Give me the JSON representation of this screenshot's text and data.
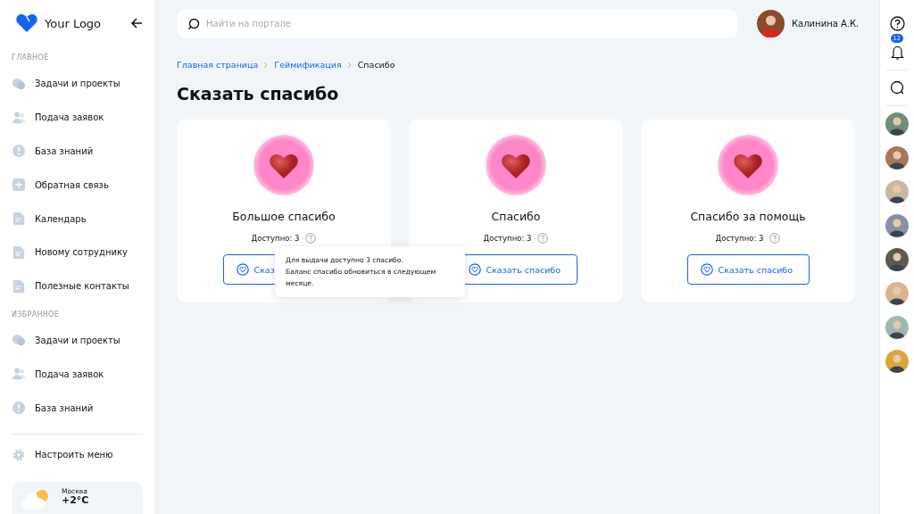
{
  "sidebar": {
    "logo": "Your Logo",
    "sections": [
      {
        "title": "ГЛАВНОЕ",
        "items": [
          {
            "label": "Задачи и проекты",
            "kind": "chat"
          },
          {
            "label": "Подача заявок",
            "kind": "people"
          },
          {
            "label": "База знаний",
            "kind": "info"
          },
          {
            "label": "Обратная связь",
            "kind": "plus"
          },
          {
            "label": "Календарь",
            "kind": "doc"
          },
          {
            "label": "Новому сотруднику",
            "kind": "doc"
          },
          {
            "label": "Полезные контакты",
            "kind": "doc"
          }
        ]
      },
      {
        "title": "ИЗБРАННОЕ",
        "items": [
          {
            "label": "Задачи и проекты",
            "kind": "chat"
          },
          {
            "label": "Подача заявок",
            "kind": "people"
          },
          {
            "label": "База знаний",
            "kind": "info"
          }
        ]
      }
    ],
    "settings": "Настроить меню",
    "weather": {
      "city": "Москва",
      "temperature": "+2°C"
    }
  },
  "search": {
    "placeholder": "Найти на портале"
  },
  "user": {
    "name": "Калинина А.К."
  },
  "breadcrumbs": [
    {
      "label": "Главная страница",
      "kind": "link"
    },
    {
      "label": "Геймификация",
      "kind": "link"
    },
    {
      "label": "Спасибо",
      "kind": "current"
    }
  ],
  "title": "Сказать спасибо",
  "cards": [
    {
      "title": "Большое спасибо",
      "available": "Доступно: 3",
      "button": "Сказ",
      "tooltip": [
        "Для выдачи доступно  3 спасибо.",
        "Баланс спасибо обновиться в следующем месяце."
      ]
    },
    {
      "title": "Спасибо",
      "available": "Доступно: 3",
      "button": "Сказать спасибо"
    },
    {
      "title": "Спасибо за помощь",
      "available": "Доступно: 3",
      "button": "Сказать спасибо"
    }
  ],
  "rail": {
    "notifications": "12",
    "contacts": [
      {
        "kind": "avatar"
      },
      {
        "kind": "avatar"
      },
      {
        "kind": "avatar"
      },
      {
        "kind": "avatar"
      },
      {
        "kind": "avatar"
      },
      {
        "kind": "avatar"
      },
      {
        "kind": "avatar"
      },
      {
        "kind": "avatar"
      }
    ]
  }
}
